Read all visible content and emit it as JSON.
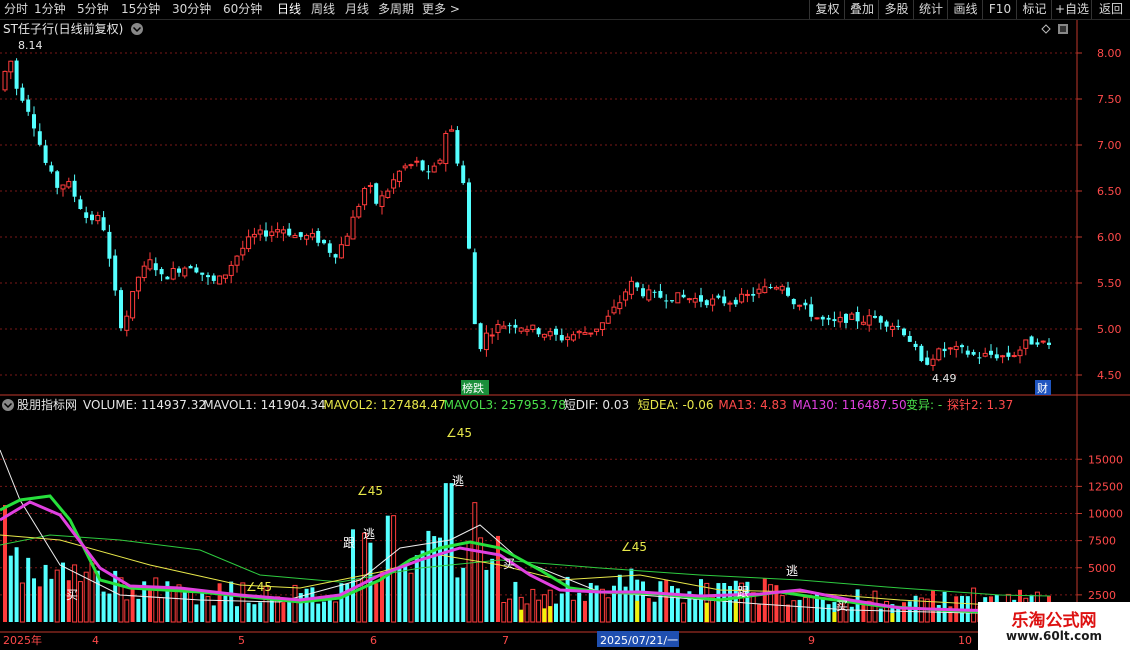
{
  "toolbar": {
    "periods": [
      "分时",
      "1分钟",
      "5分钟",
      "15分钟",
      "30分钟",
      "60分钟",
      "日线",
      "周线",
      "月线",
      "多周期"
    ],
    "active_period": "日线",
    "more": "更多",
    "right_buttons": [
      "复权",
      "叠加",
      "多股",
      "统计",
      "画线",
      "F10",
      "标记",
      "+自选",
      "返回"
    ]
  },
  "price_panel": {
    "title": "ST任子行(日线前复权)",
    "high_label": "8.14",
    "low_label": "4.49",
    "tag_bangdie": "榜跌",
    "tag_cai": "财",
    "y_ticks": [
      "8.00",
      "7.50",
      "7.00",
      "6.50",
      "6.00",
      "5.50",
      "5.00",
      "4.50"
    ]
  },
  "indicator_panel": {
    "name": "股朋指标网",
    "readouts": [
      {
        "text": "VOLUME: 114937.32",
        "color": "#e6e6e6"
      },
      {
        "text": "MAVOL1: 141904.34",
        "color": "#e6e6e6"
      },
      {
        "text": "MAVOL2: 127484.47",
        "color": "#e8e84a"
      },
      {
        "text": "MAVOL3: 257953.78",
        "color": "#4ae04a"
      },
      {
        "text": "短DIF: 0.03",
        "color": "#e6e6e6"
      },
      {
        "text": "短DEA: -0.06",
        "color": "#e8e84a"
      },
      {
        "text": "MA13: 4.83",
        "color": "#ff4a4a"
      },
      {
        "text": "MA130: 116487.50",
        "color": "#e040e0"
      },
      {
        "text": "变异: -",
        "color": "#4ae04a"
      },
      {
        "text": "探针2: 1.37",
        "color": "#ff4a4a"
      }
    ],
    "y_ticks": [
      "15000",
      "12500",
      "10000",
      "7500",
      "5000",
      "2500"
    ],
    "annotations": [
      {
        "text": "∠45",
        "color": "#e8e84a"
      },
      {
        "text": "∠45",
        "color": "#e8e84a"
      },
      {
        "text": "∠45",
        "color": "#e8e84a"
      },
      {
        "text": "∠45",
        "color": "#e8e84a"
      },
      {
        "text": "逃",
        "color": "#ffffff"
      },
      {
        "text": "逃",
        "color": "#ffffff"
      },
      {
        "text": "逃",
        "color": "#ffffff"
      },
      {
        "text": "跟",
        "color": "#ffffff"
      },
      {
        "text": "跟",
        "color": "#ffffff"
      },
      {
        "text": "买",
        "color": "#ffffff"
      },
      {
        "text": "买",
        "color": "#ffffff"
      },
      {
        "text": "买",
        "color": "#ffffff"
      }
    ]
  },
  "x_axis": {
    "labels": [
      "2025年",
      "4",
      "5",
      "6",
      "7",
      "2025/07/21/一",
      "9",
      "10"
    ]
  },
  "watermark": {
    "title": "乐淘公式网",
    "url": "www.60lt.com"
  },
  "colors": {
    "up": "#ff3c3c",
    "down": "#54ffff",
    "grid": "#7a1818",
    "axis": "#c0392b"
  }
}
